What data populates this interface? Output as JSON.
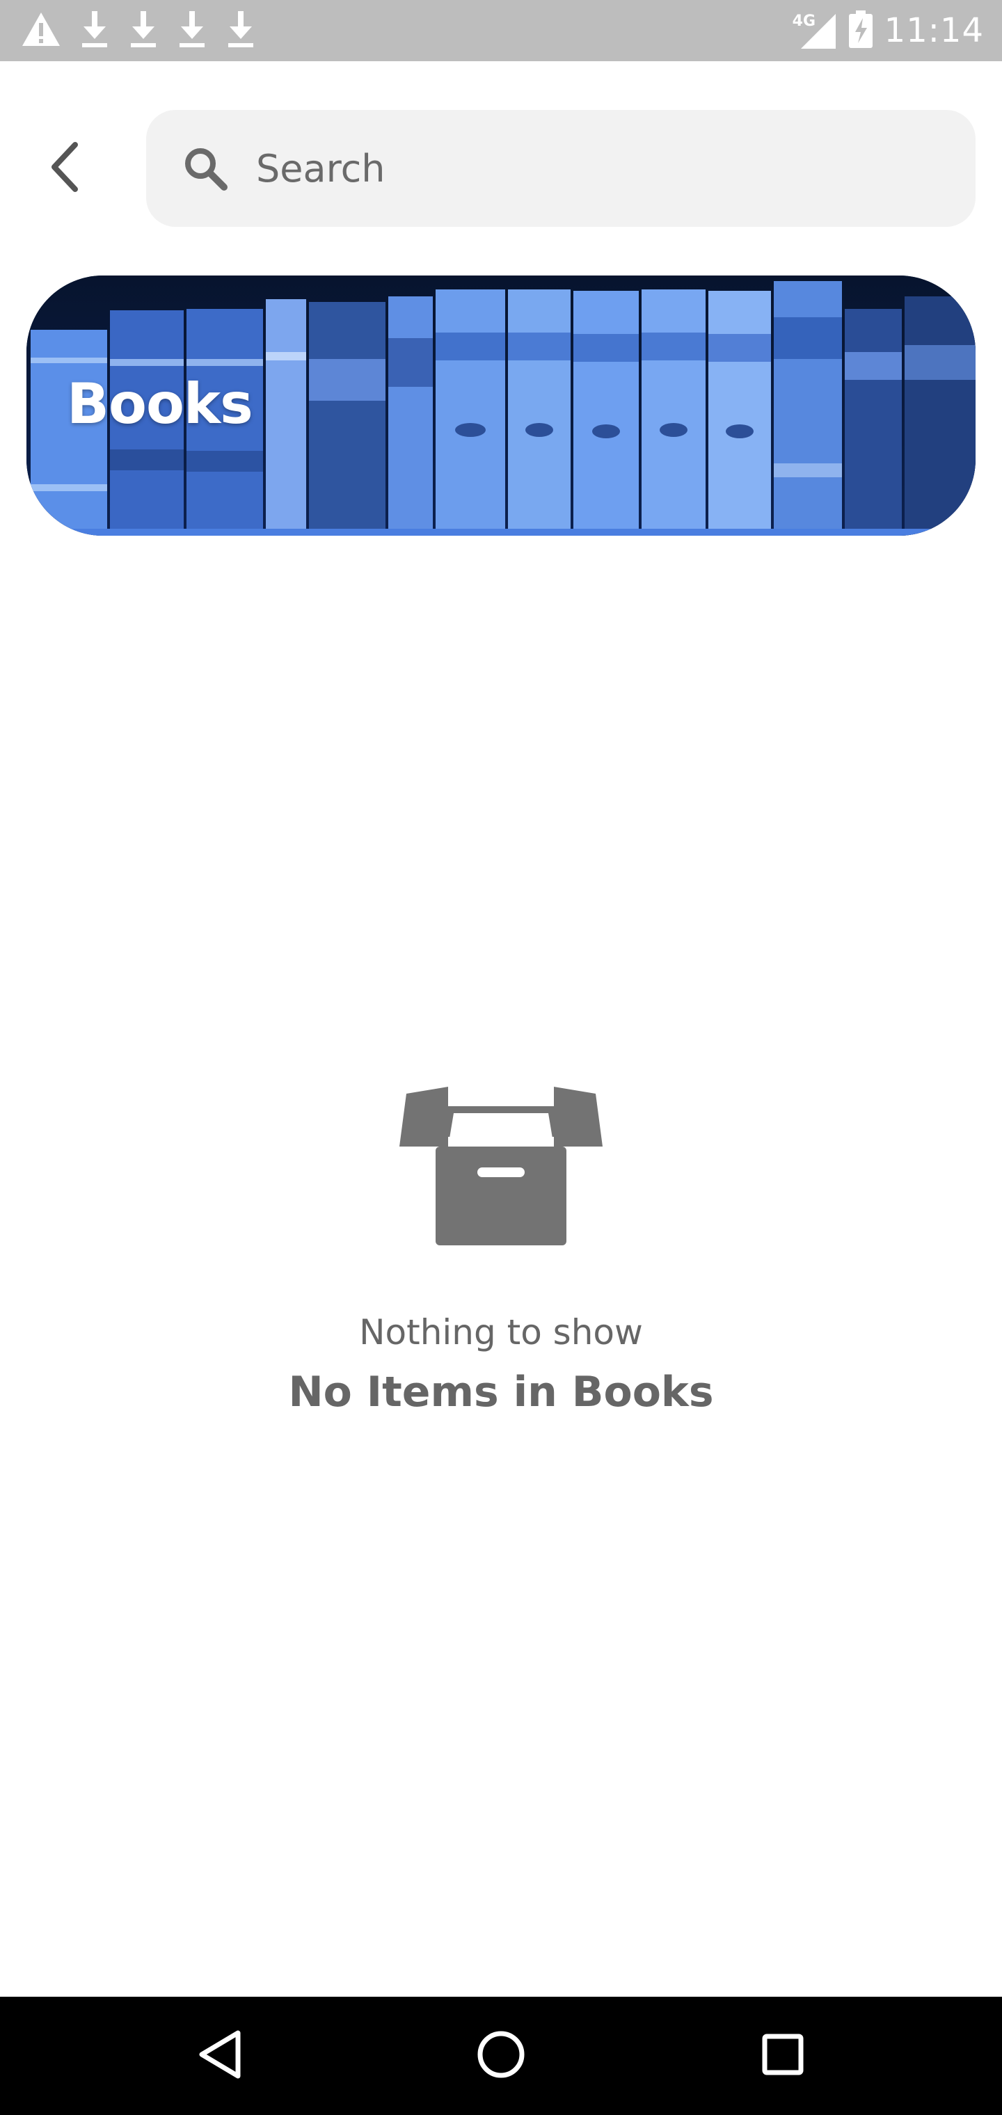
{
  "status_bar": {
    "time": "11:14",
    "network_type": "4G",
    "notification_icons": [
      "warning-icon",
      "download-icon",
      "download-icon",
      "download-icon",
      "download-icon"
    ],
    "right_icons": [
      "signal-icon",
      "battery-charging-icon"
    ]
  },
  "header": {
    "back_icon": "chevron-left-icon",
    "search_placeholder": "Search",
    "search_value": ""
  },
  "banner": {
    "title": "Books",
    "image": "bookshelf-photo"
  },
  "empty_state": {
    "icon": "open-box-icon",
    "title": "Nothing to show",
    "subtitle": "No Items in Books"
  },
  "nav_bar": {
    "buttons": [
      "back-triangle-icon",
      "home-circle-icon",
      "recents-square-icon"
    ]
  },
  "colors": {
    "status_bar_bg": "#bdbdbd",
    "search_bg": "#f2f2f2",
    "empty_text": "#666666",
    "icon_gray": "#737373",
    "banner_blue": "#4d7fe6",
    "nav_bg": "#000000"
  }
}
